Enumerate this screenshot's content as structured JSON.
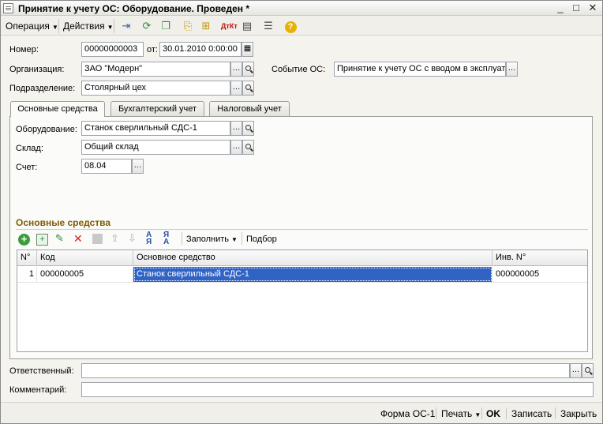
{
  "window": {
    "title": "Принятие к учету ОС: Оборудование. Проведен *"
  },
  "toolbar": {
    "operation_label": "Операция",
    "actions_label": "Действия"
  },
  "header": {
    "number_label": "Номер:",
    "number_value": "00000000003",
    "date_label": "от:",
    "date_value": "30.01.2010  0:00:00",
    "org_label": "Организация:",
    "org_value": "ЗАО \"Модерн\"",
    "event_label": "Событие ОС:",
    "event_value": "Принятие к учету ОС с вводом в эксплуат",
    "dept_label": "Подразделение:",
    "dept_value": "Столярный цех"
  },
  "tabs": [
    {
      "label": "Основные средства"
    },
    {
      "label": "Бухгалтерский учет"
    },
    {
      "label": "Налоговый учет"
    }
  ],
  "main": {
    "equipment_label": "Оборудование:",
    "equipment_value": "Станок сверлильный СДС-1",
    "warehouse_label": "Склад:",
    "warehouse_value": "Общий склад",
    "account_label": "Счет:",
    "account_value": "08.04"
  },
  "assets": {
    "section_title": "Основные средства",
    "fill_label": "Заполнить",
    "select_label": "Подбор",
    "columns": [
      "N°",
      "Код",
      "Основное средство",
      "Инв. N°"
    ],
    "rows": [
      {
        "n": "1",
        "code": "000000005",
        "asset": "Станок сверлильный СДС-1",
        "inv": "000000005"
      }
    ]
  },
  "footer": {
    "responsible_label": "Ответственный:",
    "responsible_value": "",
    "comment_label": "Комментарий:",
    "comment_value": ""
  },
  "bottom": {
    "form_label": "Форма ОС-1",
    "print_label": "Печать",
    "ok_label": "OK",
    "save_label": "Записать",
    "close_label": "Закрыть"
  },
  "colors": {
    "selection": "#3163c5",
    "section_title": "#7e5c00"
  }
}
